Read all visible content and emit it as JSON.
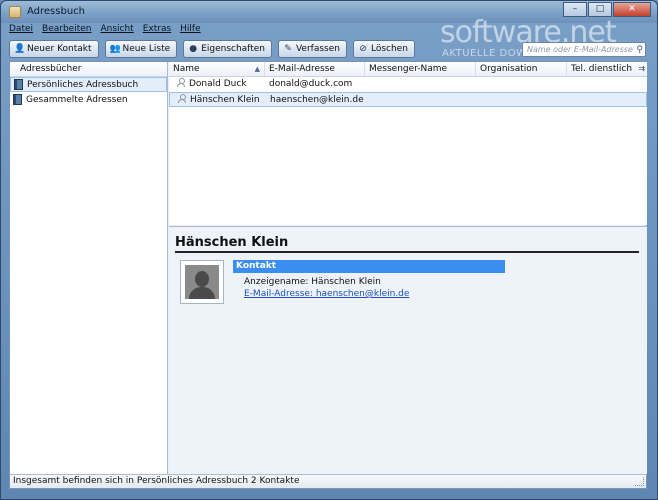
{
  "window": {
    "title": "Adressbuch"
  },
  "menu": [
    "Datei",
    "Bearbeiten",
    "Ansicht",
    "Extras",
    "Hilfe"
  ],
  "toolbar": {
    "new_contact": "Neuer Kontakt",
    "new_list": "Neue Liste",
    "properties": "Eigenschaften",
    "compose": "Verfassen",
    "delete": "Löschen"
  },
  "search": {
    "placeholder": "Name oder E-Mail-Adresse"
  },
  "watermark": {
    "main": "software.net",
    "sub": "AKTUELLE DOWNLOADS"
  },
  "sidebar": {
    "header": "Adressbücher",
    "books": [
      "Persönliches Adressbuch",
      "Gesammelte Adressen"
    ]
  },
  "contacts": {
    "columns": [
      "Name",
      "E-Mail-Adresse",
      "Messenger-Name",
      "Organisation",
      "Tel. dienstlich"
    ],
    "rows": [
      {
        "name": "Donald Duck",
        "email": "donald@duck.com"
      },
      {
        "name": "Hänschen Klein",
        "email": "haenschen@klein.de"
      }
    ]
  },
  "detail": {
    "name": "Hänschen Klein",
    "section": "Kontakt",
    "display_name": "Anzeigename: Hänschen Klein",
    "email_line": "E-Mail-Adresse: haenschen@klein.de"
  },
  "status": "Insgesamt befinden sich in Persönliches Adressbuch 2 Kontakte",
  "colors": {
    "accent": "#3a8ef0",
    "selection": "#e3eefa"
  }
}
